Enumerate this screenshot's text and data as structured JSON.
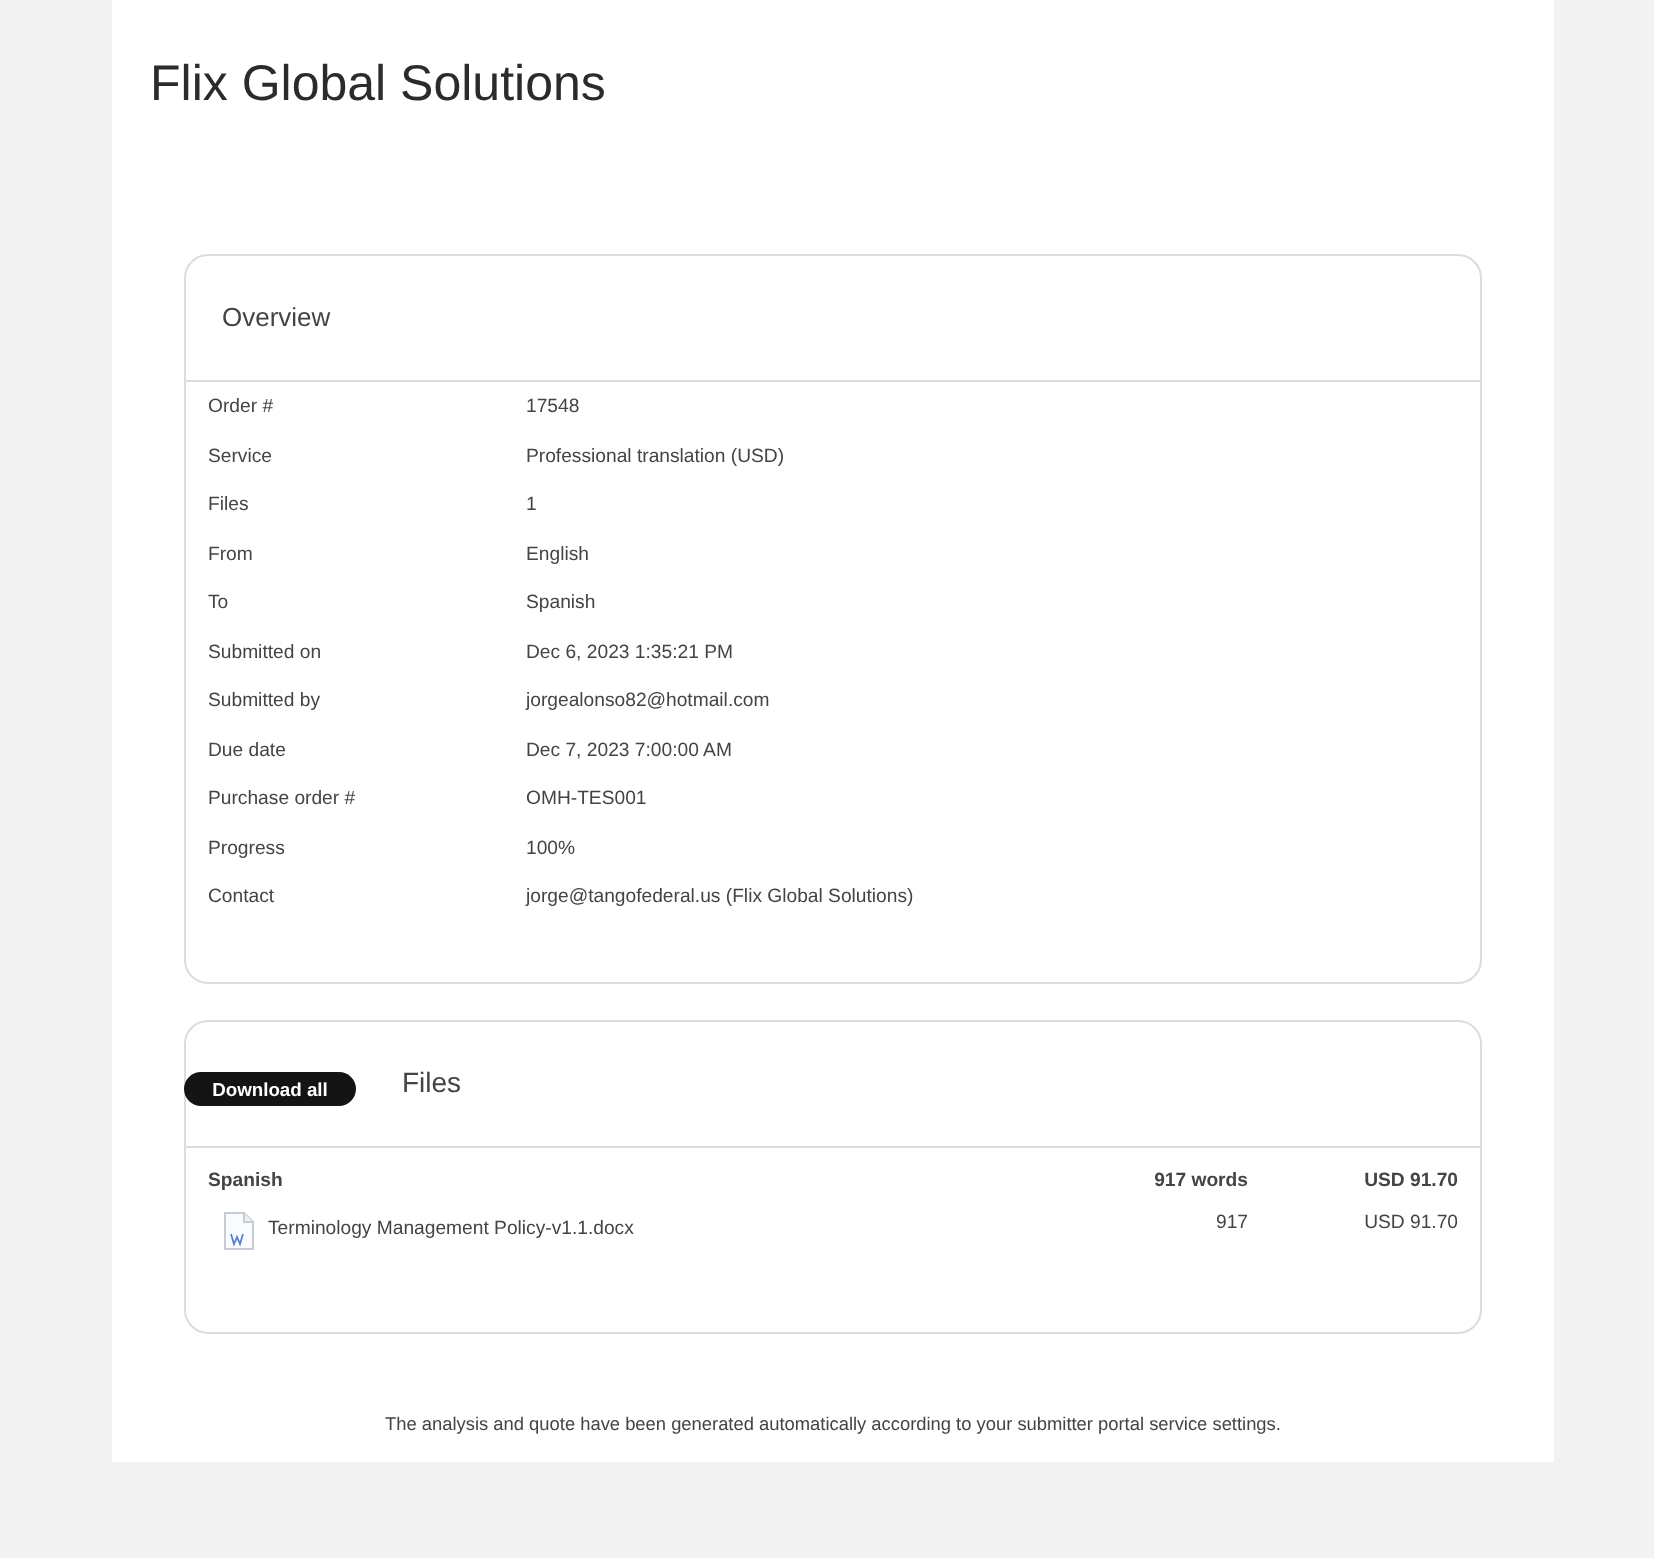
{
  "title": "Flix Global Solutions",
  "overview": {
    "heading": "Overview",
    "fields": [
      {
        "label": "Order #",
        "value": "17548"
      },
      {
        "label": "Service",
        "value": "Professional translation (USD)"
      },
      {
        "label": "Files",
        "value": "1"
      },
      {
        "label": "From",
        "value": "English"
      },
      {
        "label": "To",
        "value": "Spanish"
      },
      {
        "label": "Submitted on",
        "value": "Dec 6, 2023 1:35:21 PM"
      },
      {
        "label": "Submitted by",
        "value": "jorgealonso82@hotmail.com"
      },
      {
        "label": "Due date",
        "value": "Dec 7, 2023 7:00:00 AM"
      },
      {
        "label": "Purchase order #",
        "value": "OMH-TES001"
      },
      {
        "label": "Progress",
        "value": "100%"
      },
      {
        "label": "Contact",
        "value": "jorge@tangofederal.us (Flix Global Solutions)"
      }
    ]
  },
  "files": {
    "button": "Download all",
    "heading": "Files",
    "groups": [
      {
        "language": "Spanish",
        "words": "917 words",
        "price": "USD 91.70",
        "files": [
          {
            "name": "Terminology Management Policy-v1.1.docx",
            "words": "917",
            "price": "USD 91.70"
          }
        ]
      }
    ]
  },
  "footer_note": "The analysis and quote have been generated automatically according to your submitter portal service settings."
}
